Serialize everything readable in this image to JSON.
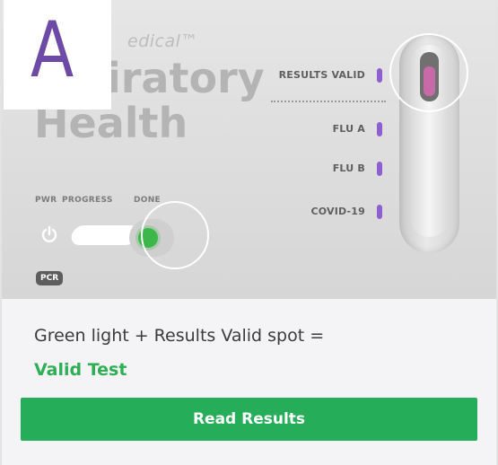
{
  "device": {
    "brand_text": "edical™",
    "title": "Respiratory\nHealth",
    "title_visible": "   piratory\nHealth",
    "overlay_letter": "A",
    "indicators": {
      "pwr": "PWR",
      "progress": "PROGRESS",
      "done": "DONE"
    },
    "badge": "PCR",
    "results": [
      {
        "label": "RESULTS VALID"
      },
      {
        "label": "FLU A"
      },
      {
        "label": "FLU B"
      },
      {
        "label": "COVID-19"
      }
    ]
  },
  "caption": {
    "line": "Green light + Results Valid spot =",
    "emphasis": "Valid Test"
  },
  "actions": {
    "read_results": "Read Results"
  },
  "colors": {
    "accent_green": "#26ad5a",
    "valid_text": "#2fae55",
    "indicator_purple": "#8e5fce",
    "label_purple": "#6c4aa6",
    "done_light": "#3cb84a"
  }
}
